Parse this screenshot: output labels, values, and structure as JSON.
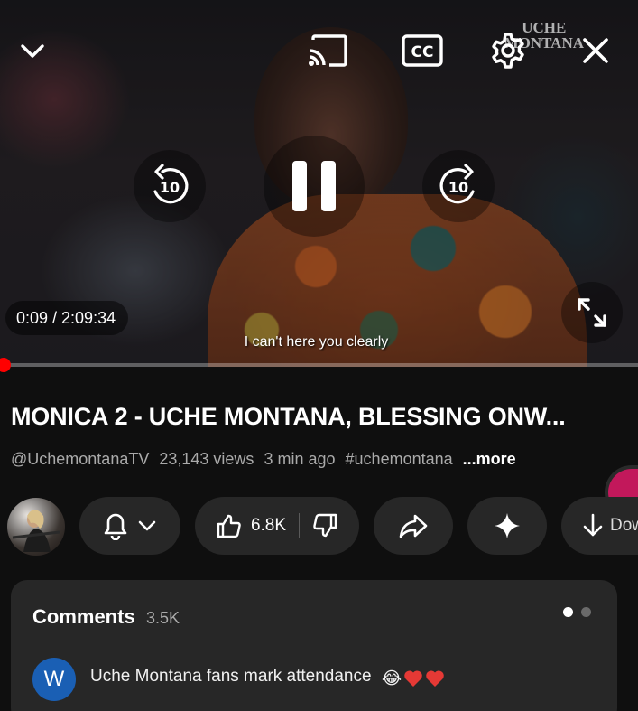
{
  "player": {
    "watermark_line1": "UCHE",
    "watermark_line2": "MONTANA",
    "current_time": "0:09",
    "duration": "2:09:34",
    "time_display": "0:09 / 2:09:34",
    "subtitle": "I can't here you clearly",
    "progress_fraction": 0.001,
    "rewind_seconds": "10",
    "forward_seconds": "10",
    "icons": {
      "collapse": "chevron-down-icon",
      "cast": "cast-icon",
      "captions": "cc-icon",
      "settings": "gear-icon",
      "close": "close-icon",
      "rewind": "rewind-10-icon",
      "pause": "pause-icon",
      "forward": "forward-10-icon",
      "fullscreen": "fullscreen-icon"
    },
    "captions_label": "CC"
  },
  "video": {
    "title": "MONICA 2 - UCHE MONTANA, BLESSING ONW...",
    "channel": "@UchemontanaTV",
    "views": "23,143 views",
    "age": "3 min ago",
    "hashtag": "#uchemontana",
    "more_label": "...more"
  },
  "actions": {
    "like_count": "6.8K",
    "download_label": "Dow",
    "icons": {
      "bell": "bell-icon",
      "chevron": "chevron-down-icon",
      "like": "thumbs-up-icon",
      "dislike": "thumbs-down-icon",
      "share": "share-icon",
      "remix": "sparkle-icon",
      "download": "download-icon"
    }
  },
  "comments": {
    "title": "Comments",
    "count": "3.5K",
    "pager_active_index": 0,
    "pager_total": 2,
    "top_comment": {
      "avatar_letter": "W",
      "text": "Uche Montana fans mark attendance",
      "emoji": "😂"
    }
  },
  "colors": {
    "background": "#0f0f0f",
    "chip": "#272727",
    "accent_red": "#ff0000",
    "secondary_text": "#aaaaaa",
    "avatar_blue": "#1a5fb4",
    "heart_red": "#e53935"
  }
}
